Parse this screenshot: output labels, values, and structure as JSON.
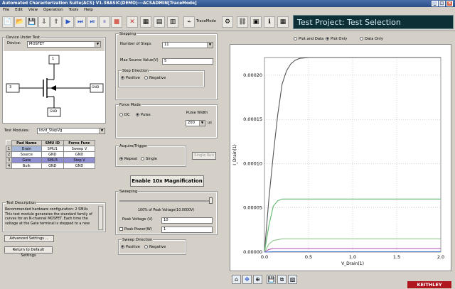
{
  "window": {
    "title": "Automated Characterization Suite(ACS) V1.3BASIC(DEMO)---ACSADMIN[TraceMode]"
  },
  "menu": [
    "File",
    "Edit",
    "View",
    "Operation",
    "Tools",
    "Help"
  ],
  "toolbar": {
    "tracemode_label": "TraceMode",
    "banner": "Test Project: Test Selection"
  },
  "device": {
    "group": "Device Under Test",
    "label": "Device:",
    "value": "MOSFET",
    "pin_left": "3",
    "pin_top": "1",
    "pin_right": "GND",
    "pin_bottom": "GND"
  },
  "modules": {
    "label": "Test Modules:",
    "value": "Idvd_StepVg"
  },
  "pins": {
    "headers": [
      "Pad Name",
      "SMU ID",
      "Force Func"
    ],
    "rows": [
      {
        "n": "1",
        "pad": "Drain",
        "smu": "SMU1",
        "func": "Sweep V"
      },
      {
        "n": "2",
        "pad": "Source",
        "smu": "GND",
        "func": "GND"
      },
      {
        "n": "3",
        "pad": "Gate",
        "smu": "SMU3",
        "func": "Step V"
      },
      {
        "n": "4",
        "pad": "Bulk",
        "smu": "GND",
        "func": "GND"
      }
    ]
  },
  "desc": {
    "group": "Test Description",
    "text": "Recommended hardware configuration: 2 SMUs This test module generates the standard family of curves for an N-channel MOSFET. Each time the voltage at the Gate terminal is stepped to a new"
  },
  "buttons": {
    "advanced": "Advanced Settings ...",
    "defaults": "Return to Default Settings",
    "single_run": "Single Run",
    "magnify": "Enable 10x Magnification"
  },
  "stepping": {
    "group": "Stepping",
    "steps_label": "Number of Steps",
    "steps_value": "11",
    "max_label": "Max Source Value(V)",
    "max_value": "5",
    "dir_group": "Step Direction",
    "positive": "Positive",
    "negative": "Negative"
  },
  "force": {
    "group": "Force Mode",
    "dc": "DC",
    "pulse": "Pulse",
    "width_label": "Pulse Width",
    "width_value": "200",
    "unit": "us"
  },
  "acquire": {
    "group": "Acquire/Trigger",
    "repeat": "Repeat",
    "single": "Single"
  },
  "sweeping": {
    "group": "Sweeping",
    "pct_label": "100% of Peak Voltage(10.0000V)",
    "peak_label": "Peak Voltage (V)",
    "peak_value": "10",
    "power_label": "Peak Power(W)",
    "power_value": "1",
    "dir_group": "Sweep Direction",
    "positive": "Positive",
    "negative": "Negative"
  },
  "plot_opts": {
    "plot_data": "Plot and Data",
    "plot_only": "Plot Only",
    "data_only": "Data Only"
  },
  "brand": "KEITHLEY",
  "chart_data": {
    "type": "line",
    "xlabel": "V_Drain(1)",
    "ylabel": "I_Drain(1)",
    "xlim": [
      0,
      2.0
    ],
    "ylim": [
      0,
      0.00022
    ],
    "xticks": [
      "0.0",
      "0.5",
      "1.0",
      "1.5",
      "2.0"
    ],
    "yticks": [
      "0.00000",
      "0.00005",
      "0.00010",
      "0.00015",
      "0.00020"
    ],
    "grid": true,
    "series": [
      {
        "color": "#555555",
        "x": [
          0,
          0.05,
          0.1,
          0.15,
          0.2,
          0.25,
          0.3,
          0.35,
          0.4,
          0.5,
          0.6,
          0.8,
          1.0,
          1.5,
          2.0
        ],
        "y": [
          0,
          6e-05,
          0.00011,
          0.000155,
          0.00019,
          0.000205,
          0.000213,
          0.000217,
          0.000219,
          0.00022,
          0.00022,
          0.00022,
          0.00022,
          0.00022,
          0.00022
        ]
      },
      {
        "color": "#5fb86a",
        "x": [
          0,
          0.05,
          0.1,
          0.15,
          0.2,
          0.3,
          0.5,
          1.0,
          1.5,
          2.0
        ],
        "y": [
          0,
          3e-05,
          5.2e-05,
          5.8e-05,
          6e-05,
          6e-05,
          6e-05,
          6e-05,
          6e-05,
          6e-05
        ]
      },
      {
        "color": "#8fc98f",
        "x": [
          0,
          0.05,
          0.1,
          0.2,
          0.5,
          1.0,
          2.0
        ],
        "y": [
          0,
          9e-06,
          1.3e-05,
          1.5e-05,
          1.5e-05,
          1.5e-05,
          1.5e-05
        ]
      },
      {
        "color": "#b04fb0",
        "x": [
          0,
          0.05,
          0.1,
          0.2,
          0.5,
          1.0,
          2.0
        ],
        "y": [
          0,
          3e-06,
          4e-06,
          4e-06,
          4e-06,
          4e-06,
          4e-06
        ]
      },
      {
        "color": "#4a7ad0",
        "x": [
          0,
          0.1,
          0.5,
          1.0,
          2.0
        ],
        "y": [
          0,
          5e-07,
          5e-07,
          5e-07,
          5e-07
        ]
      }
    ]
  }
}
